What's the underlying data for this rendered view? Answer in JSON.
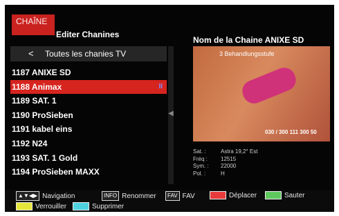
{
  "header": {
    "brand": "CHAÎNE",
    "title": "Editer Chanines"
  },
  "subheader": {
    "chevron": "<",
    "label": "Toutes les chanies TV"
  },
  "channels": [
    {
      "label": "1187 ANIXE SD",
      "selected": false
    },
    {
      "label": "1188 Animax",
      "selected": true,
      "fav_mark": "II"
    },
    {
      "label": "1189 SAT. 1",
      "selected": false
    },
    {
      "label": "1190 ProSieben",
      "selected": false
    },
    {
      "label": "1191 kabel eins",
      "selected": false
    },
    {
      "label": "1192 N24",
      "selected": false
    },
    {
      "label": "1193 SAT. 1 Gold",
      "selected": false
    },
    {
      "label": "1194 ProSieben MAXX",
      "selected": false
    }
  ],
  "right": {
    "title": "Nom de la Chaine ANIXE SD",
    "preview_text": "3 Behandlungsstufe",
    "preview_phone": "030 / 300 111 300 50"
  },
  "info": [
    {
      "key": "Sat. :",
      "value": "Astra 19,2° Est"
    },
    {
      "key": "Fréq :",
      "value": "12515"
    },
    {
      "key": "Sym. :",
      "value": "22000"
    },
    {
      "key": "Pol. :",
      "value": "H"
    }
  ],
  "footer": {
    "navigation": "Navigation",
    "info_key": "INFO",
    "rename": "Renommer",
    "fav_key": "FAV",
    "fav": "FAV",
    "move": "Déplacer",
    "skip": "Sauter",
    "lock": "Verrouiller",
    "delete": "Supprimer"
  },
  "colors": {
    "accent_red": "#d6241f",
    "btn_red": "#e83a3a",
    "btn_green": "#5ec85e",
    "btn_yellow": "#e6e63a",
    "btn_cyan": "#4fd2e0"
  }
}
